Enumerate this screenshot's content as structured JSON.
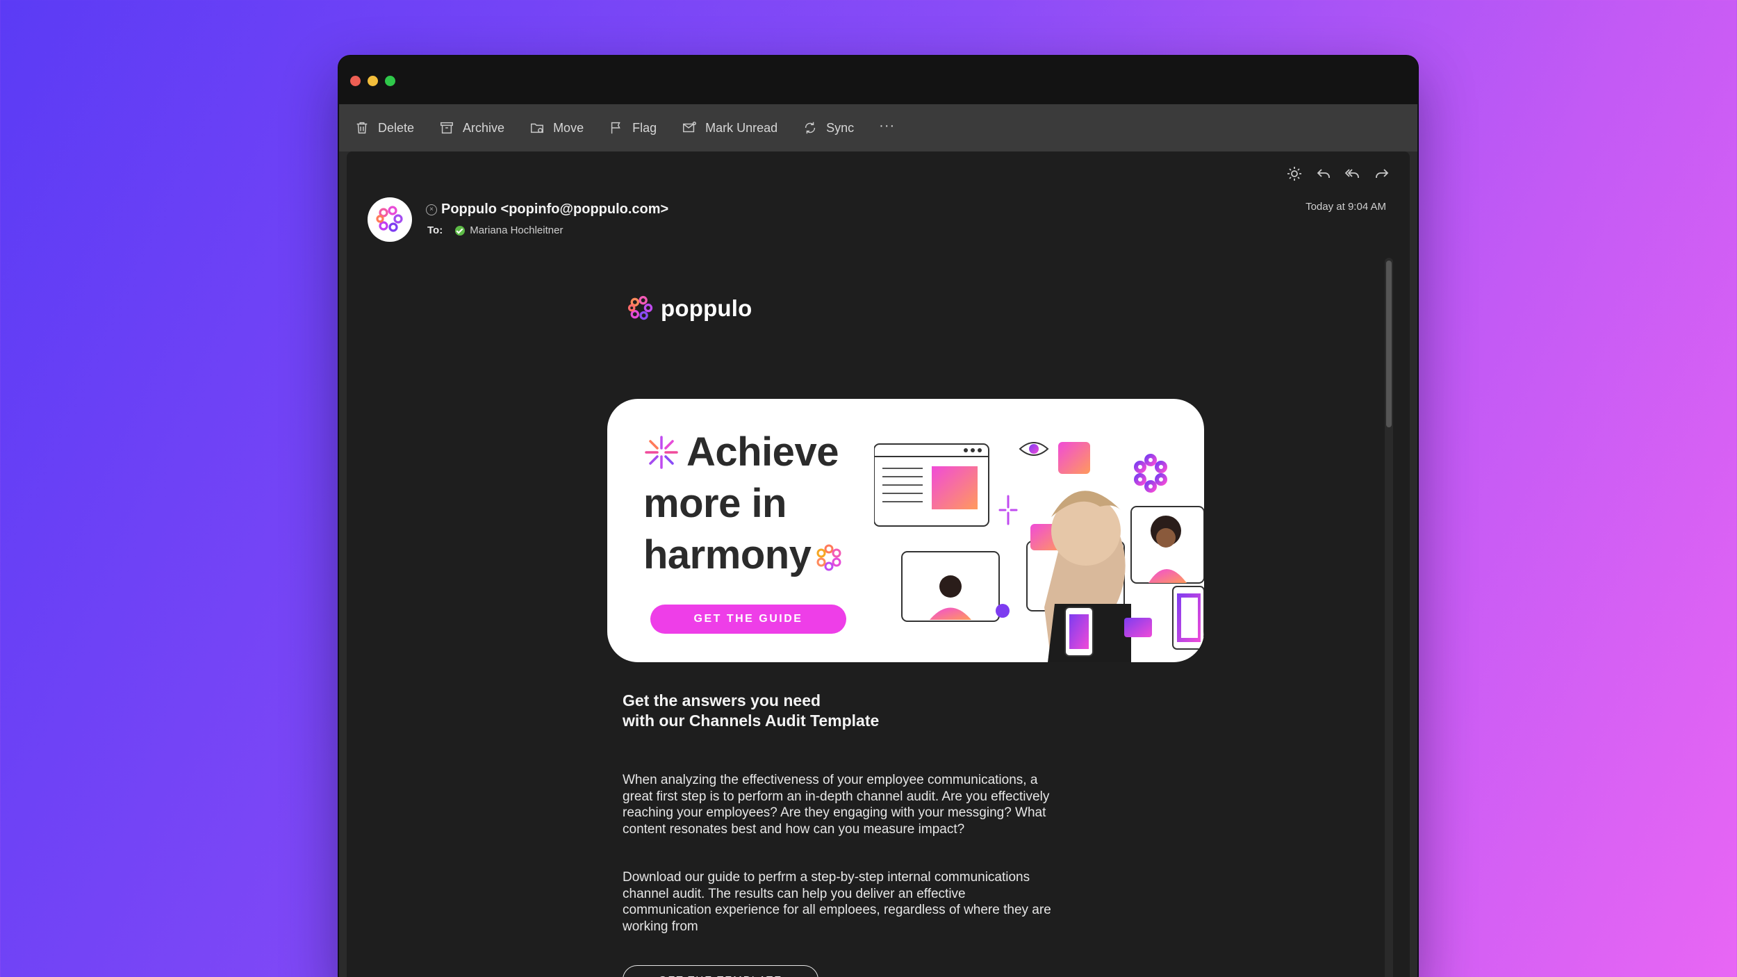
{
  "toolbar": {
    "items": [
      {
        "label": "Delete",
        "icon": "trash-icon"
      },
      {
        "label": "Archive",
        "icon": "archive-icon"
      },
      {
        "label": "Move",
        "icon": "folder-move-icon"
      },
      {
        "label": "Flag",
        "icon": "flag-icon"
      },
      {
        "label": "Mark Unread",
        "icon": "envelope-icon"
      },
      {
        "label": "Sync",
        "icon": "sync-icon"
      }
    ],
    "more": "···"
  },
  "message": {
    "from": "Poppulo <popinfo@poppulo.com>",
    "to_label": "To:",
    "to_name": "Mariana Hochleitner",
    "time": "Today at 9:04 AM"
  },
  "email": {
    "logo_text": "poppulo",
    "hero": {
      "line1": "Achieve",
      "line2": "more in",
      "line3": "harmony",
      "cta": "GET THE GUIDE"
    },
    "title_line1": "Get the answers you need",
    "title_line2": "with our Channels Audit Template",
    "paragraph1": "When analyzing the effectiveness of your employee communications, a great first step is to perform an in-depth channel audit. Are you effectively reaching your employees? Are they engaging with your messging? What content resonates best and how can you measure impact?",
    "paragraph2": "Download our guide to perfrm a step-by-step internal communications channel audit. The results can help you deliver an effective communication experience for all emploees, regardless of where they are working from",
    "cta2": "GET THE TEMPLATE"
  },
  "colors": {
    "accent_pink": "#ee3ee8",
    "window_bg": "#1e1e1e",
    "toolbar_bg": "#3b3b3b"
  }
}
